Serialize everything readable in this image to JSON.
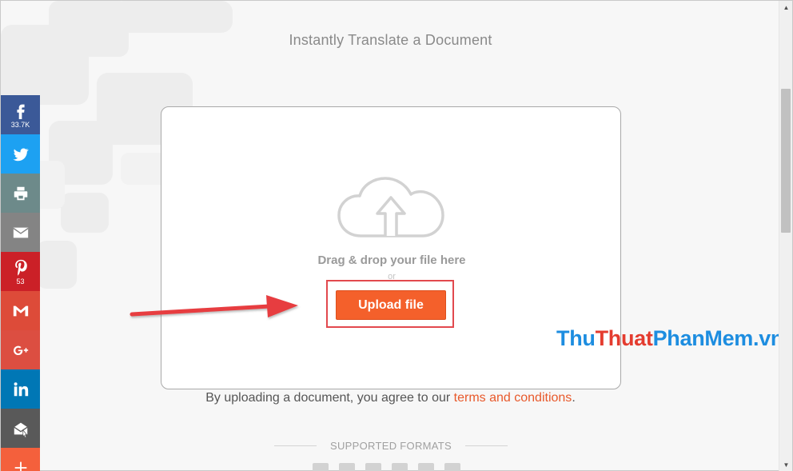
{
  "page": {
    "title": "Instantly Translate a Document"
  },
  "dropzone": {
    "drag_text": "Drag & drop your file here",
    "or_text": "or",
    "upload_label": "Upload file"
  },
  "agreement": {
    "prefix": "By uploading a document, you agree to our ",
    "link": "terms and conditions",
    "suffix": "."
  },
  "formats": {
    "label": "SUPPORTED FORMATS"
  },
  "watermark": {
    "part1": "Thu",
    "part2": "Thuat",
    "part3": "Phan",
    "part4": "Mem",
    "part5": ".vn"
  },
  "share": [
    {
      "name": "facebook",
      "icon": "facebook-icon",
      "color": "#3b5998",
      "count": "33.7K"
    },
    {
      "name": "twitter",
      "icon": "twitter-icon",
      "color": "#1da1f2",
      "count": ""
    },
    {
      "name": "print",
      "icon": "printer-icon",
      "color": "#6d8a8a",
      "count": ""
    },
    {
      "name": "email",
      "icon": "envelope-icon",
      "color": "#848484",
      "count": ""
    },
    {
      "name": "pinterest",
      "icon": "pinterest-icon",
      "color": "#cb2027",
      "count": "53"
    },
    {
      "name": "gmail",
      "icon": "gmail-icon",
      "color": "#dd4b39",
      "count": ""
    },
    {
      "name": "google-plus",
      "icon": "google-plus-icon",
      "color": "#dc4e41",
      "count": ""
    },
    {
      "name": "linkedin",
      "icon": "linkedin-icon",
      "color": "#0077b5",
      "count": ""
    },
    {
      "name": "email-app",
      "icon": "mail-open-icon",
      "color": "#595959",
      "count": ""
    },
    {
      "name": "more",
      "icon": "plus-icon",
      "color": "#f4603c",
      "count": ""
    }
  ],
  "colors": {
    "accent": "#f4602b",
    "link": "#e8592b",
    "highlight": "#e2494e"
  }
}
